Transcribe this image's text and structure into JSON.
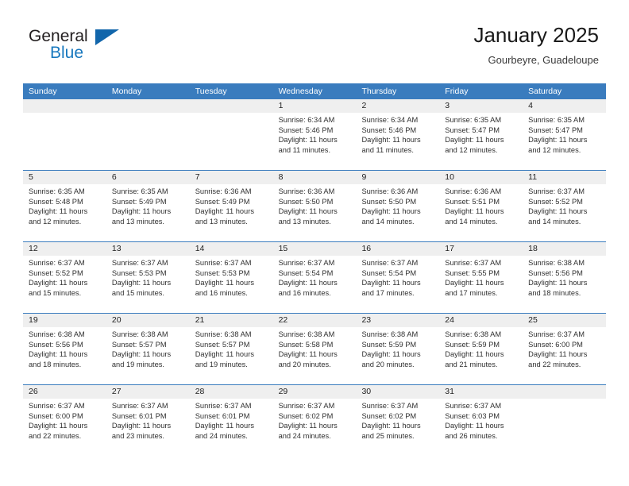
{
  "brand": {
    "word_one": "General",
    "word_two": "Blue",
    "triangle_icon": "brand-triangle-icon"
  },
  "header": {
    "title": "January 2025",
    "subtitle": "Gourbeyre, Guadeloupe"
  },
  "colors": {
    "header_blue": "#3a7cbe",
    "brand_blue": "#1878be",
    "daynum_band": "#efefef",
    "text": "#222222"
  },
  "calendar": {
    "day_names": [
      "Sunday",
      "Monday",
      "Tuesday",
      "Wednesday",
      "Thursday",
      "Friday",
      "Saturday"
    ],
    "weeks": [
      [
        {
          "day": "",
          "lines": []
        },
        {
          "day": "",
          "lines": []
        },
        {
          "day": "",
          "lines": []
        },
        {
          "day": "1",
          "lines": [
            "Sunrise: 6:34 AM",
            "Sunset: 5:46 PM",
            "Daylight: 11 hours",
            "and 11 minutes."
          ]
        },
        {
          "day": "2",
          "lines": [
            "Sunrise: 6:34 AM",
            "Sunset: 5:46 PM",
            "Daylight: 11 hours",
            "and 11 minutes."
          ]
        },
        {
          "day": "3",
          "lines": [
            "Sunrise: 6:35 AM",
            "Sunset: 5:47 PM",
            "Daylight: 11 hours",
            "and 12 minutes."
          ]
        },
        {
          "day": "4",
          "lines": [
            "Sunrise: 6:35 AM",
            "Sunset: 5:47 PM",
            "Daylight: 11 hours",
            "and 12 minutes."
          ]
        }
      ],
      [
        {
          "day": "5",
          "lines": [
            "Sunrise: 6:35 AM",
            "Sunset: 5:48 PM",
            "Daylight: 11 hours",
            "and 12 minutes."
          ]
        },
        {
          "day": "6",
          "lines": [
            "Sunrise: 6:35 AM",
            "Sunset: 5:49 PM",
            "Daylight: 11 hours",
            "and 13 minutes."
          ]
        },
        {
          "day": "7",
          "lines": [
            "Sunrise: 6:36 AM",
            "Sunset: 5:49 PM",
            "Daylight: 11 hours",
            "and 13 minutes."
          ]
        },
        {
          "day": "8",
          "lines": [
            "Sunrise: 6:36 AM",
            "Sunset: 5:50 PM",
            "Daylight: 11 hours",
            "and 13 minutes."
          ]
        },
        {
          "day": "9",
          "lines": [
            "Sunrise: 6:36 AM",
            "Sunset: 5:50 PM",
            "Daylight: 11 hours",
            "and 14 minutes."
          ]
        },
        {
          "day": "10",
          "lines": [
            "Sunrise: 6:36 AM",
            "Sunset: 5:51 PM",
            "Daylight: 11 hours",
            "and 14 minutes."
          ]
        },
        {
          "day": "11",
          "lines": [
            "Sunrise: 6:37 AM",
            "Sunset: 5:52 PM",
            "Daylight: 11 hours",
            "and 14 minutes."
          ]
        }
      ],
      [
        {
          "day": "12",
          "lines": [
            "Sunrise: 6:37 AM",
            "Sunset: 5:52 PM",
            "Daylight: 11 hours",
            "and 15 minutes."
          ]
        },
        {
          "day": "13",
          "lines": [
            "Sunrise: 6:37 AM",
            "Sunset: 5:53 PM",
            "Daylight: 11 hours",
            "and 15 minutes."
          ]
        },
        {
          "day": "14",
          "lines": [
            "Sunrise: 6:37 AM",
            "Sunset: 5:53 PM",
            "Daylight: 11 hours",
            "and 16 minutes."
          ]
        },
        {
          "day": "15",
          "lines": [
            "Sunrise: 6:37 AM",
            "Sunset: 5:54 PM",
            "Daylight: 11 hours",
            "and 16 minutes."
          ]
        },
        {
          "day": "16",
          "lines": [
            "Sunrise: 6:37 AM",
            "Sunset: 5:54 PM",
            "Daylight: 11 hours",
            "and 17 minutes."
          ]
        },
        {
          "day": "17",
          "lines": [
            "Sunrise: 6:37 AM",
            "Sunset: 5:55 PM",
            "Daylight: 11 hours",
            "and 17 minutes."
          ]
        },
        {
          "day": "18",
          "lines": [
            "Sunrise: 6:38 AM",
            "Sunset: 5:56 PM",
            "Daylight: 11 hours",
            "and 18 minutes."
          ]
        }
      ],
      [
        {
          "day": "19",
          "lines": [
            "Sunrise: 6:38 AM",
            "Sunset: 5:56 PM",
            "Daylight: 11 hours",
            "and 18 minutes."
          ]
        },
        {
          "day": "20",
          "lines": [
            "Sunrise: 6:38 AM",
            "Sunset: 5:57 PM",
            "Daylight: 11 hours",
            "and 19 minutes."
          ]
        },
        {
          "day": "21",
          "lines": [
            "Sunrise: 6:38 AM",
            "Sunset: 5:57 PM",
            "Daylight: 11 hours",
            "and 19 minutes."
          ]
        },
        {
          "day": "22",
          "lines": [
            "Sunrise: 6:38 AM",
            "Sunset: 5:58 PM",
            "Daylight: 11 hours",
            "and 20 minutes."
          ]
        },
        {
          "day": "23",
          "lines": [
            "Sunrise: 6:38 AM",
            "Sunset: 5:59 PM",
            "Daylight: 11 hours",
            "and 20 minutes."
          ]
        },
        {
          "day": "24",
          "lines": [
            "Sunrise: 6:38 AM",
            "Sunset: 5:59 PM",
            "Daylight: 11 hours",
            "and 21 minutes."
          ]
        },
        {
          "day": "25",
          "lines": [
            "Sunrise: 6:37 AM",
            "Sunset: 6:00 PM",
            "Daylight: 11 hours",
            "and 22 minutes."
          ]
        }
      ],
      [
        {
          "day": "26",
          "lines": [
            "Sunrise: 6:37 AM",
            "Sunset: 6:00 PM",
            "Daylight: 11 hours",
            "and 22 minutes."
          ]
        },
        {
          "day": "27",
          "lines": [
            "Sunrise: 6:37 AM",
            "Sunset: 6:01 PM",
            "Daylight: 11 hours",
            "and 23 minutes."
          ]
        },
        {
          "day": "28",
          "lines": [
            "Sunrise: 6:37 AM",
            "Sunset: 6:01 PM",
            "Daylight: 11 hours",
            "and 24 minutes."
          ]
        },
        {
          "day": "29",
          "lines": [
            "Sunrise: 6:37 AM",
            "Sunset: 6:02 PM",
            "Daylight: 11 hours",
            "and 24 minutes."
          ]
        },
        {
          "day": "30",
          "lines": [
            "Sunrise: 6:37 AM",
            "Sunset: 6:02 PM",
            "Daylight: 11 hours",
            "and 25 minutes."
          ]
        },
        {
          "day": "31",
          "lines": [
            "Sunrise: 6:37 AM",
            "Sunset: 6:03 PM",
            "Daylight: 11 hours",
            "and 26 minutes."
          ]
        },
        {
          "day": "",
          "lines": []
        }
      ]
    ]
  }
}
